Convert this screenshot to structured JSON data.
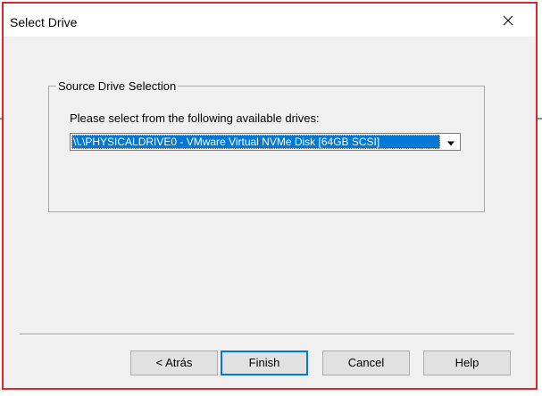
{
  "window": {
    "title": "Select Drive"
  },
  "group": {
    "legend": "Source Drive Selection",
    "prompt": "Please select from the following available drives:",
    "drive_select": {
      "selected": "\\\\.\\PHYSICALDRIVE0 - VMware Virtual NVMe Disk [64GB SCSI]"
    }
  },
  "buttons": {
    "back": "< Atrás",
    "finish": "Finish",
    "cancel": "Cancel",
    "help": "Help"
  },
  "colors": {
    "selection": "#0078d7",
    "highlight_border": "#d9262b",
    "dialog_background": "#f0f0f0"
  },
  "icons": {
    "close": "close-icon",
    "dropdown": "chevron-down-icon"
  }
}
